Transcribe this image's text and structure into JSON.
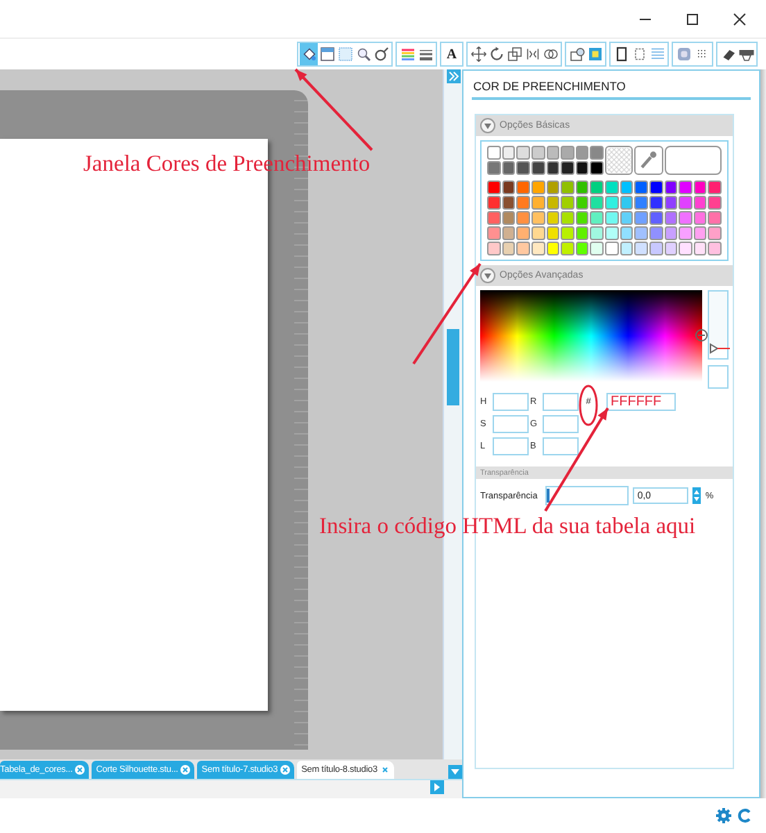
{
  "toolbar": {
    "groups": [
      [
        {
          "kind": "fill",
          "selected": true
        },
        {
          "kind": "window",
          "selected": false
        },
        {
          "kind": "pattern",
          "selected": false
        },
        {
          "kind": "search",
          "selected": false
        },
        {
          "kind": "ring",
          "selected": false
        }
      ],
      [
        {
          "kind": "colorbars",
          "selected": false
        },
        {
          "kind": "linebars",
          "selected": false
        }
      ],
      [
        {
          "kind": "text",
          "label": "A",
          "selected": false
        }
      ],
      [
        {
          "kind": "move",
          "selected": false
        },
        {
          "kind": "rotate",
          "selected": false
        },
        {
          "kind": "scale",
          "selected": false
        },
        {
          "kind": "mirror",
          "selected": false
        },
        {
          "kind": "overlap",
          "selected": false
        }
      ],
      [
        {
          "kind": "offset",
          "selected": false
        },
        {
          "kind": "square",
          "selected": false
        }
      ],
      [
        {
          "kind": "page",
          "selected": false
        },
        {
          "kind": "frame",
          "selected": false
        },
        {
          "kind": "lines",
          "selected": false
        }
      ],
      [
        {
          "kind": "target",
          "selected": false
        },
        {
          "kind": "dots",
          "selected": false
        }
      ],
      [
        {
          "kind": "eraser",
          "selected": false
        },
        {
          "kind": "machine",
          "selected": false
        }
      ]
    ]
  },
  "document_tabs": [
    {
      "label": "Tabela_de_cores...",
      "selected": false
    },
    {
      "label": "Corte Silhouette.stu...",
      "selected": false
    },
    {
      "label": "Sem título-7.studio3",
      "selected": false
    },
    {
      "label": "Sem título-8.studio3",
      "selected": true
    }
  ],
  "fill_panel": {
    "title": "COR DE PREENCHIMENTO",
    "basic": {
      "header": "Opções Básicas",
      "expanded": true,
      "current": {
        "color": "#ffffff"
      },
      "grays": [
        {
          "color": "#ffffff"
        },
        {
          "color": "#eeeeee"
        },
        {
          "color": "#dddddd"
        },
        {
          "color": "#cccccc"
        },
        {
          "color": "#bbbbbb"
        },
        {
          "color": "#aaaaaa"
        },
        {
          "color": "#999999"
        },
        {
          "color": "#888888"
        },
        {
          "color": "#777777"
        },
        {
          "color": "#666666"
        },
        {
          "color": "#555555"
        },
        {
          "color": "#444444"
        },
        {
          "color": "#333333"
        },
        {
          "color": "#222222"
        },
        {
          "color": "#111111"
        },
        {
          "color": "#000000"
        }
      ],
      "palette": [
        [
          {
            "color": "#ff0000"
          },
          {
            "color": "#7a3a20"
          },
          {
            "color": "#ff6600"
          },
          {
            "color": "#ffa500"
          },
          {
            "color": "#b0a000"
          },
          {
            "color": "#90c000"
          },
          {
            "color": "#30c000"
          },
          {
            "color": "#00d080"
          },
          {
            "color": "#00e0c0"
          },
          {
            "color": "#00c0ff"
          },
          {
            "color": "#0060ff"
          },
          {
            "color": "#0000ff"
          },
          {
            "color": "#8000ff"
          },
          {
            "color": "#e000ff"
          },
          {
            "color": "#ff00c0"
          },
          {
            "color": "#ff2070"
          }
        ],
        [
          {
            "color": "#ff3030"
          },
          {
            "color": "#8a5030"
          },
          {
            "color": "#ff7a20"
          },
          {
            "color": "#ffb030"
          },
          {
            "color": "#c8b800"
          },
          {
            "color": "#a0d000"
          },
          {
            "color": "#40d000"
          },
          {
            "color": "#20e0a0"
          },
          {
            "color": "#30f0e0"
          },
          {
            "color": "#30c8f0"
          },
          {
            "color": "#3080ff"
          },
          {
            "color": "#3030ff"
          },
          {
            "color": "#9040ff"
          },
          {
            "color": "#e040ff"
          },
          {
            "color": "#ff40d0"
          },
          {
            "color": "#ff4090"
          }
        ],
        [
          {
            "color": "#ff6060"
          },
          {
            "color": "#b08a60"
          },
          {
            "color": "#ff9040"
          },
          {
            "color": "#ffc060"
          },
          {
            "color": "#e0d000"
          },
          {
            "color": "#a8e000"
          },
          {
            "color": "#50e000"
          },
          {
            "color": "#60f0c0"
          },
          {
            "color": "#70f8f0"
          },
          {
            "color": "#60d0f8"
          },
          {
            "color": "#70a0ff"
          },
          {
            "color": "#6060ff"
          },
          {
            "color": "#b070ff"
          },
          {
            "color": "#f070ff"
          },
          {
            "color": "#ff70e0"
          },
          {
            "color": "#ff70a8"
          }
        ],
        [
          {
            "color": "#ff9090"
          },
          {
            "color": "#d0b090"
          },
          {
            "color": "#ffb070"
          },
          {
            "color": "#ffd890"
          },
          {
            "color": "#f0e000"
          },
          {
            "color": "#b8f000"
          },
          {
            "color": "#60f000"
          },
          {
            "color": "#a0f8e0"
          },
          {
            "color": "#b0fff8"
          },
          {
            "color": "#90e0ff"
          },
          {
            "color": "#a0c0ff"
          },
          {
            "color": "#9090ff"
          },
          {
            "color": "#c8a0ff"
          },
          {
            "color": "#f8a0ff"
          },
          {
            "color": "#ffa0f0"
          },
          {
            "color": "#ffa0c8"
          }
        ],
        [
          {
            "color": "#ffc8c8"
          },
          {
            "color": "#e8d0b0"
          },
          {
            "color": "#ffc8a0"
          },
          {
            "color": "#ffe8c0"
          },
          {
            "color": "#ffff00"
          },
          {
            "color": "#c0f000"
          },
          {
            "color": "#60ff00"
          },
          {
            "color": "#e0fff0"
          },
          {
            "color": "#ffffff"
          },
          {
            "color": "#c0f0ff"
          },
          {
            "color": "#d0e0ff"
          },
          {
            "color": "#c8c8ff"
          },
          {
            "color": "#e0d0ff"
          },
          {
            "color": "#ffe0ff"
          },
          {
            "color": "#ffe0f8"
          },
          {
            "color": "#ffc0e0"
          }
        ]
      ]
    },
    "advanced": {
      "header": "Opções Avançadas",
      "expanded": true,
      "lightness": {
        "level": 0.85
      },
      "fields": [
        {
          "label": "H"
        },
        {
          "label": "R"
        },
        {
          "label": "S"
        },
        {
          "label": "G"
        },
        {
          "label": "L"
        },
        {
          "label": "B"
        }
      ],
      "hex": {
        "label": "#",
        "value": "FFFFFF"
      }
    },
    "transparency": {
      "header": "Transparência",
      "label": "Transparência",
      "level": 0,
      "value": "0,0",
      "unit": "%"
    }
  },
  "annotations": [
    {
      "text": "Janela Cores de Preenchimento"
    },
    {
      "text": "Insira o código HTML da sua tabela aqui"
    }
  ]
}
